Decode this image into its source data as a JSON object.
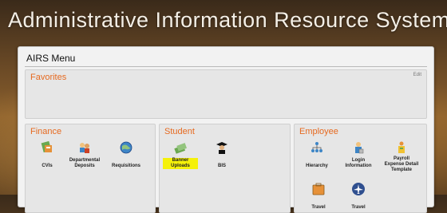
{
  "header": {
    "title": "Administrative Information Resource System"
  },
  "menu": {
    "title": "AIRS Menu",
    "favorites": {
      "title": "Favorites",
      "edit_label": "Edit"
    },
    "finance": {
      "title": "Finance",
      "items": [
        {
          "label": "CVIs",
          "icon": "cvi-icon"
        },
        {
          "label": "Departmental Deposits",
          "icon": "deposits-icon"
        },
        {
          "label": "Requisitions",
          "icon": "globe-icon"
        }
      ]
    },
    "student": {
      "title": "Student",
      "items": [
        {
          "label": "Banner Uploads",
          "icon": "banner-uploads-icon",
          "highlight": true
        },
        {
          "label": "BIS",
          "icon": "graduate-icon"
        }
      ]
    },
    "employee": {
      "title": "Employee",
      "items": [
        {
          "label": "Hierarchy",
          "icon": "hierarchy-icon"
        },
        {
          "label": "Login Information",
          "icon": "login-icon"
        },
        {
          "label": "Payroll Expense Detail Template",
          "icon": "payroll-icon"
        },
        {
          "label": "Travel",
          "icon": "travel-icon"
        },
        {
          "label": "Travel",
          "icon": "travel-plane-icon"
        }
      ]
    }
  },
  "colors": {
    "section_title": "#e66a20",
    "highlight": "#f5f10a"
  }
}
